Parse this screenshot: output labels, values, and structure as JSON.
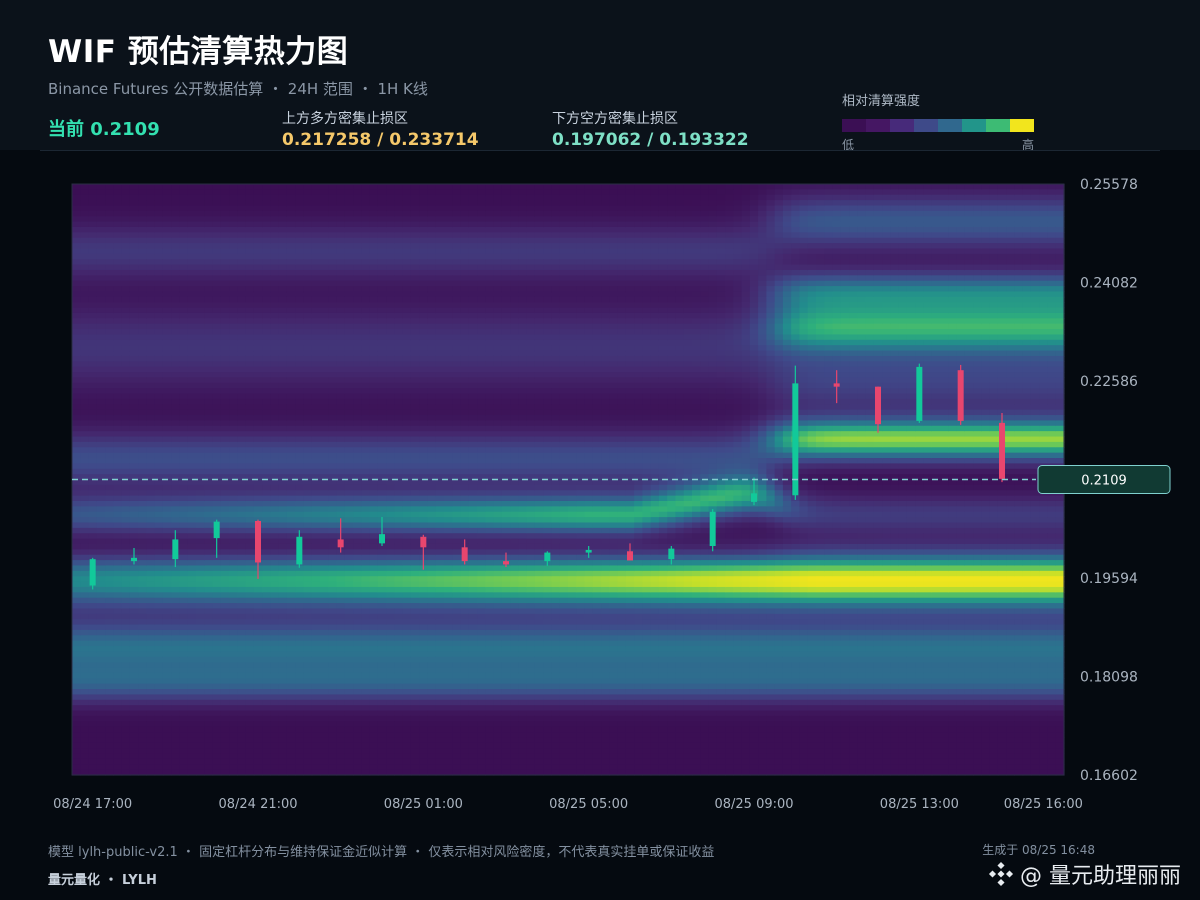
{
  "header": {
    "title": "WIF 预估清算热力图",
    "subtitle": "Binance Futures 公开数据估算 ・ 24H 范围 ・ 1H K线",
    "current_price_label": "当前 0.2109",
    "upper_zone_label": "上方多方密集止损区",
    "upper_zone_value": "0.217258 / 0.233714",
    "lower_zone_label": "下方空方密集止损区",
    "lower_zone_value": "0.197062 / 0.193322"
  },
  "legend": {
    "title": "相对清算强度",
    "low": "低",
    "high": "高",
    "colors": [
      "#3b0f54",
      "#451763",
      "#472a7a",
      "#3e4a89",
      "#30688e",
      "#22958a",
      "#3dbb74",
      "#f2e51d"
    ]
  },
  "colors": {
    "bull": "#12c99a",
    "bear": "#e8466e",
    "current_line": "#7fd1cf",
    "price_tag_bg": "#113a33",
    "price_tag_border": "#7fd1cf"
  },
  "chart_data": {
    "type": "heatmap",
    "x_ticks": [
      "08/24 17:00",
      "08/24 21:00",
      "08/25 01:00",
      "08/25 05:00",
      "08/25 09:00",
      "08/25 13:00",
      "08/25 16:00"
    ],
    "x_tick_hours": [
      0,
      4,
      8,
      12,
      16,
      20,
      23
    ],
    "x_range_hours": [
      -0.5,
      23.5
    ],
    "y_ticks": [
      "0.25578",
      "0.24082",
      "0.22586",
      "0.21090",
      "0.19594",
      "0.18098",
      "0.16602"
    ],
    "y_tick_labels": [
      "0.25578",
      "0.24082",
      "0.22586",
      "",
      "0.19594",
      "0.18098",
      "0.16602"
    ],
    "ylim": [
      0.16602,
      0.25578
    ],
    "current_price": 0.2109,
    "current_price_tag": "0.2109",
    "candles": [
      {
        "t": 0,
        "o": 0.1948,
        "h": 0.199,
        "l": 0.1942,
        "c": 0.1988
      },
      {
        "t": 1,
        "o": 0.1985,
        "h": 0.2005,
        "l": 0.198,
        "c": 0.199
      },
      {
        "t": 2,
        "o": 0.1988,
        "h": 0.2032,
        "l": 0.1976,
        "c": 0.2018
      },
      {
        "t": 3,
        "o": 0.202,
        "h": 0.2048,
        "l": 0.199,
        "c": 0.2045
      },
      {
        "t": 4,
        "o": 0.2046,
        "h": 0.2048,
        "l": 0.1958,
        "c": 0.1983
      },
      {
        "t": 5,
        "o": 0.198,
        "h": 0.2032,
        "l": 0.1975,
        "c": 0.2022
      },
      {
        "t": 6,
        "o": 0.2018,
        "h": 0.205,
        "l": 0.1998,
        "c": 0.2006
      },
      {
        "t": 7,
        "o": 0.2012,
        "h": 0.2052,
        "l": 0.2008,
        "c": 0.2026
      },
      {
        "t": 8,
        "o": 0.2022,
        "h": 0.2025,
        "l": 0.1972,
        "c": 0.2006
      },
      {
        "t": 9,
        "o": 0.2006,
        "h": 0.2018,
        "l": 0.198,
        "c": 0.1985
      },
      {
        "t": 10,
        "o": 0.1985,
        "h": 0.1998,
        "l": 0.1976,
        "c": 0.198
      },
      {
        "t": 11,
        "o": 0.1985,
        "h": 0.2,
        "l": 0.1978,
        "c": 0.1998
      },
      {
        "t": 12,
        "o": 0.1998,
        "h": 0.2008,
        "l": 0.199,
        "c": 0.2002
      },
      {
        "t": 13,
        "o": 0.2,
        "h": 0.2012,
        "l": 0.1986,
        "c": 0.1986
      },
      {
        "t": 14,
        "o": 0.1988,
        "h": 0.2008,
        "l": 0.198,
        "c": 0.2004
      },
      {
        "t": 15,
        "o": 0.2008,
        "h": 0.2064,
        "l": 0.2,
        "c": 0.206
      },
      {
        "t": 16,
        "o": 0.2075,
        "h": 0.2112,
        "l": 0.207,
        "c": 0.2088
      },
      {
        "t": 17,
        "o": 0.2085,
        "h": 0.2282,
        "l": 0.2078,
        "c": 0.2255
      },
      {
        "t": 18,
        "o": 0.2255,
        "h": 0.2275,
        "l": 0.2225,
        "c": 0.225
      },
      {
        "t": 19,
        "o": 0.225,
        "h": 0.225,
        "l": 0.218,
        "c": 0.2193
      },
      {
        "t": 20,
        "o": 0.2198,
        "h": 0.2285,
        "l": 0.2195,
        "c": 0.228
      },
      {
        "t": 21,
        "o": 0.2275,
        "h": 0.2283,
        "l": 0.2192,
        "c": 0.2198
      },
      {
        "t": 22,
        "o": 0.2195,
        "h": 0.221,
        "l": 0.2105,
        "c": 0.211
      },
      {
        "t": 23,
        "o": 0.211,
        "h": 0.2115,
        "l": 0.2106,
        "c": 0.2109
      }
    ]
  },
  "footer": {
    "note": "模型 lylh-public-v2.1 ・ 固定杠杆分布与维持保证金近似计算 ・ 仅表示相对风险密度，不代表真实挂单或保证收益",
    "generated": "生成于 08/25 16:48",
    "brand": "量元量化 ・ LYLH",
    "watermark": "@ 量元助理丽丽"
  }
}
